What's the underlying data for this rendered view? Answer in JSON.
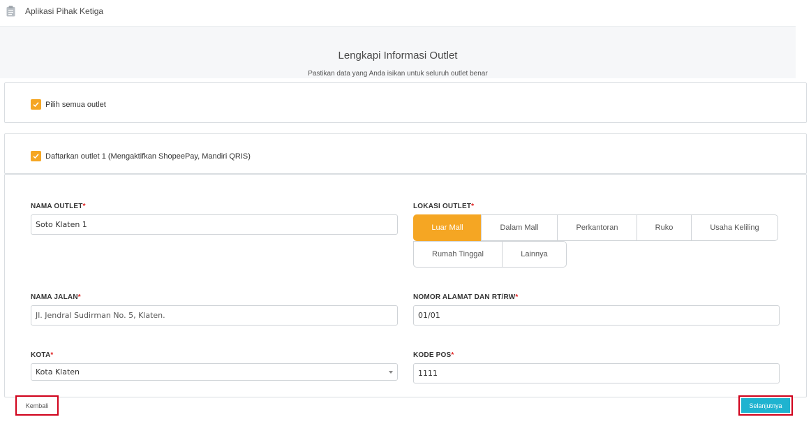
{
  "app": {
    "title": "Aplikasi Pihak Ketiga",
    "icon": "clipboard-icon"
  },
  "header": {
    "title": "Lengkapi Informasi Outlet",
    "subtitle": "Pastikan data yang Anda isikan untuk seluruh outlet benar"
  },
  "select_all": {
    "label": "Pilih semua outlet",
    "checked": true
  },
  "outlet": {
    "label": "Daftarkan outlet 1 (Mengaktifkan ShopeePay, Mandiri QRIS)",
    "checked": true
  },
  "form": {
    "nama_outlet": {
      "label": "NAMA OUTLET",
      "required": "*",
      "value": "Soto Klaten 1"
    },
    "lokasi_outlet": {
      "label": "LOKASI OUTLET",
      "required": "*",
      "options": [
        "Luar Mall",
        "Dalam Mall",
        "Perkantoran",
        "Ruko",
        "Usaha Keliling",
        "Rumah Tinggal",
        "Lainnya"
      ],
      "selected": "Luar Mall"
    },
    "nama_jalan": {
      "label": "NAMA JALAN",
      "required": "*",
      "value": "Jl. Jendral Sudirman No. 5, Klaten."
    },
    "nomor_alamat": {
      "label": "NOMOR ALAMAT DAN RT/RW",
      "required": "*",
      "value": "01/01"
    },
    "kota": {
      "label": "KOTA",
      "required": "*",
      "value": "Kota Klaten"
    },
    "kode_pos": {
      "label": "KODE POS",
      "required": "*",
      "value": "1111"
    }
  },
  "footer": {
    "back_label": "Kembali",
    "next_label": "Selanjutnya"
  },
  "colors": {
    "accent": "#f5a623",
    "primary": "#1fb3d0",
    "required": "#e02020",
    "highlight_border": "#d0021b"
  }
}
